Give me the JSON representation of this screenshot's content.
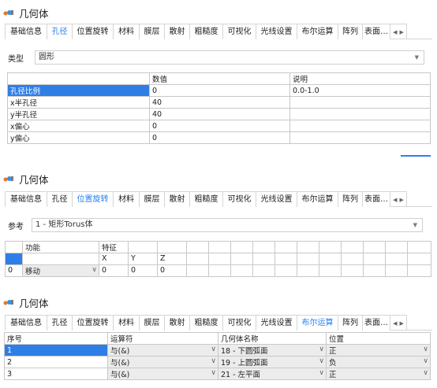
{
  "panel1": {
    "title": "几何体",
    "tabs": [
      "基础信息",
      "孔径",
      "位置旋转",
      "材料",
      "膜层",
      "散射",
      "粗糙度",
      "可视化",
      "光线设置",
      "布尔运算",
      "阵列",
      "表面…"
    ],
    "active_tab": "孔径",
    "type_label": "类型",
    "type_value": "圆形",
    "table": {
      "headers": [
        "",
        "数值",
        "说明"
      ],
      "rows": [
        [
          "孔径比例",
          "0",
          "0.0-1.0"
        ],
        [
          "x半孔径",
          "40",
          ""
        ],
        [
          "y半孔径",
          "40",
          ""
        ],
        [
          "x偏心",
          "0",
          ""
        ],
        [
          "y偏心",
          "0",
          ""
        ]
      ]
    }
  },
  "panel2": {
    "title": "几何体",
    "tabs": [
      "基础信息",
      "孔径",
      "位置旋转",
      "材料",
      "膜层",
      "散射",
      "粗糙度",
      "可视化",
      "光线设置",
      "布尔运算",
      "阵列",
      "表面…"
    ],
    "active_tab": "位置旋转",
    "ref_label": "参考",
    "ref_value": "1 - 矩形Torus体",
    "table": {
      "header1": [
        "",
        "功能",
        "特征"
      ],
      "header2": [
        "",
        "",
        "X",
        "Y",
        "Z"
      ],
      "rows": [
        [
          "0",
          "移动",
          "0",
          "0",
          "0"
        ]
      ]
    }
  },
  "panel3": {
    "title": "几何体",
    "tabs": [
      "基础信息",
      "孔径",
      "位置旋转",
      "材料",
      "膜层",
      "散射",
      "粗糙度",
      "可视化",
      "光线设置",
      "布尔运算",
      "阵列",
      "表面…"
    ],
    "active_tab": "布尔运算",
    "table": {
      "headers": [
        "序号",
        "运算符",
        "几何体名称",
        "位置"
      ],
      "rows": [
        [
          "1",
          "与(&)",
          "18 - 下圆弧面",
          "正"
        ],
        [
          "2",
          "与(&)",
          "19 - 上圆弧面",
          "负"
        ],
        [
          "3",
          "与(&)",
          "21 - 左平面",
          "正"
        ]
      ]
    }
  },
  "colors": {
    "accent": "#2a7ff0",
    "selection": "#2f7ee6"
  },
  "icons": [
    "app-icon",
    "dropdown-arrow-icon",
    "tab-scroll-left-icon",
    "tab-scroll-right-icon"
  ]
}
